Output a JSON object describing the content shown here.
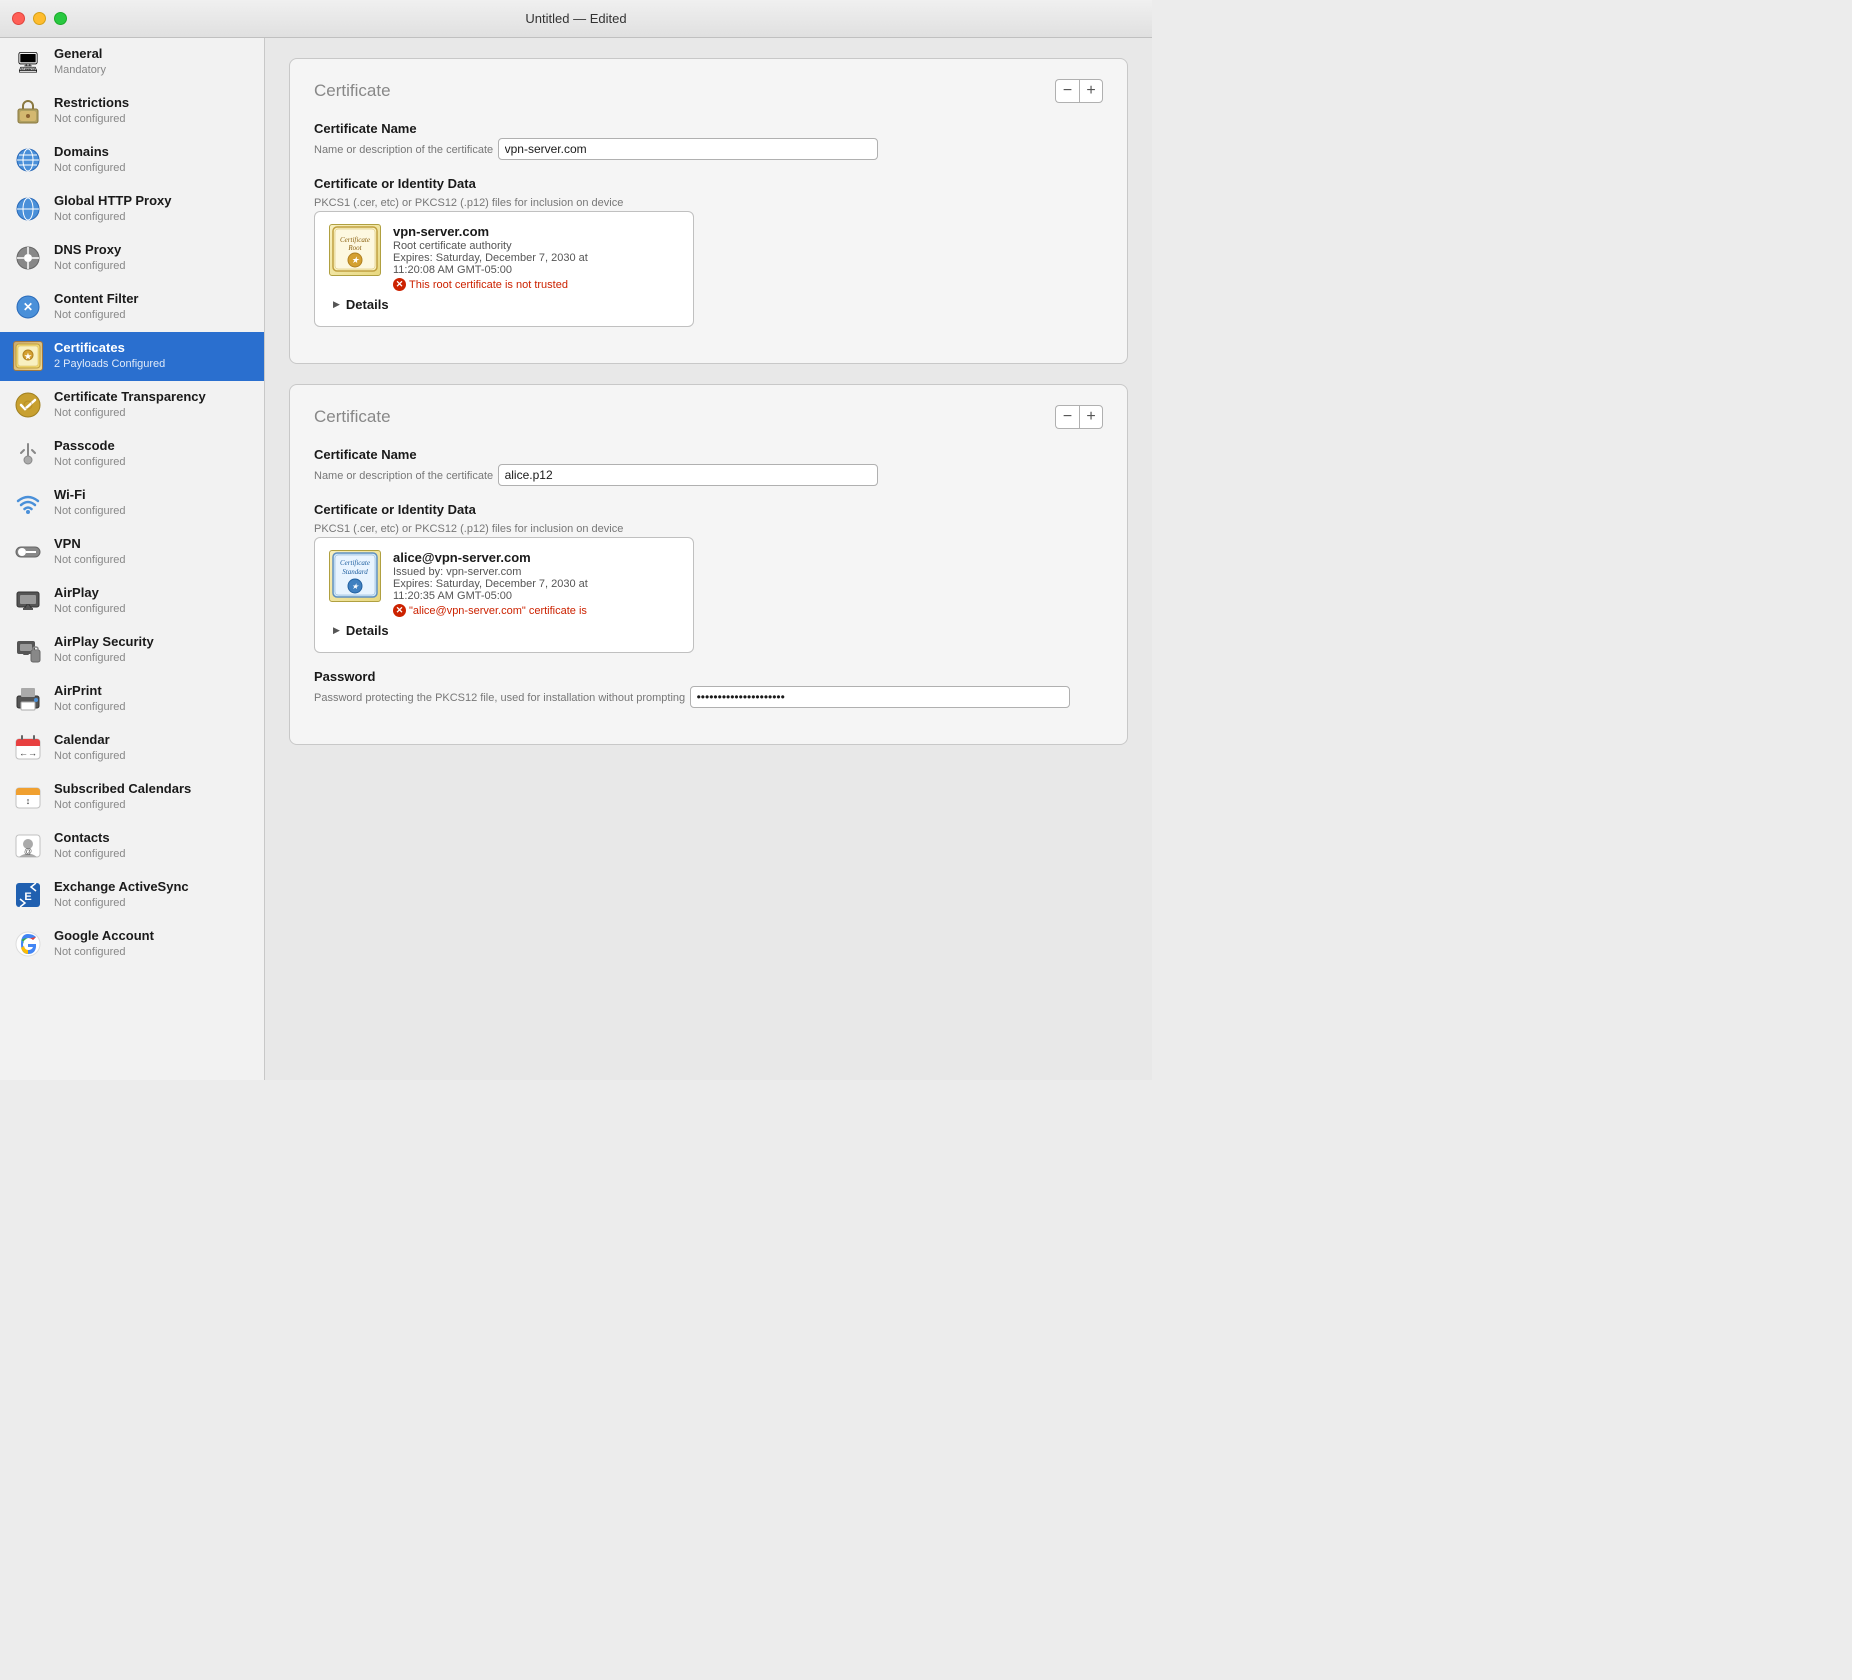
{
  "window": {
    "title": "Untitled — Edited"
  },
  "sidebar": {
    "items": [
      {
        "id": "general",
        "title": "General",
        "subtitle": "Mandatory",
        "icon": "🖥"
      },
      {
        "id": "restrictions",
        "title": "Restrictions",
        "subtitle": "Not configured",
        "icon": "🔒"
      },
      {
        "id": "domains",
        "title": "Domains",
        "subtitle": "Not configured",
        "icon": "🌐"
      },
      {
        "id": "global-http-proxy",
        "title": "Global HTTP Proxy",
        "subtitle": "Not configured",
        "icon": "🌐"
      },
      {
        "id": "dns-proxy",
        "title": "DNS Proxy",
        "subtitle": "Not configured",
        "icon": "🔧"
      },
      {
        "id": "content-filter",
        "title": "Content Filter",
        "subtitle": "Not configured",
        "icon": "🌐"
      },
      {
        "id": "certificates",
        "title": "Certificates",
        "subtitle": "2 Payloads Configured",
        "icon": "cert",
        "active": true
      },
      {
        "id": "cert-transparency",
        "title": "Certificate Transparency",
        "subtitle": "Not configured",
        "icon": "⚙️"
      },
      {
        "id": "passcode",
        "title": "Passcode",
        "subtitle": "Not configured",
        "icon": "🔑"
      },
      {
        "id": "wifi",
        "title": "Wi-Fi",
        "subtitle": "Not configured",
        "icon": "wifi"
      },
      {
        "id": "vpn",
        "title": "VPN",
        "subtitle": "Not configured",
        "icon": "vpn"
      },
      {
        "id": "airplay",
        "title": "AirPlay",
        "subtitle": "Not configured",
        "icon": "airplay"
      },
      {
        "id": "airplay-security",
        "title": "AirPlay Security",
        "subtitle": "Not configured",
        "icon": "airplay-sec"
      },
      {
        "id": "airprint",
        "title": "AirPrint",
        "subtitle": "Not configured",
        "icon": "print"
      },
      {
        "id": "calendar",
        "title": "Calendar",
        "subtitle": "Not configured",
        "icon": "cal"
      },
      {
        "id": "subscribed-calendars",
        "title": "Subscribed Calendars",
        "subtitle": "Not configured",
        "icon": "subcal"
      },
      {
        "id": "contacts",
        "title": "Contacts",
        "subtitle": "Not configured",
        "icon": "contacts"
      },
      {
        "id": "exchange-activesync",
        "title": "Exchange ActiveSync",
        "subtitle": "Not configured",
        "icon": "exchange"
      },
      {
        "id": "google-account",
        "title": "Google Account",
        "subtitle": "Not configured",
        "icon": "google"
      }
    ]
  },
  "main": {
    "cert1": {
      "section_title": "Certificate",
      "cert_name_label": "Certificate Name",
      "cert_name_desc": "Name or description of the certificate",
      "cert_name_value": "vpn-server.com",
      "cert_data_label": "Certificate or Identity Data",
      "cert_data_desc": "PKCS1 (.cer, etc) or PKCS12 (.p12) files for inclusion on device",
      "cert_cn": "vpn-server.com",
      "cert_type": "Root certificate authority",
      "cert_expires": "Expires: Saturday, December 7, 2030 at",
      "cert_expires2": "11:20:08 AM GMT-05:00",
      "cert_error": "This root certificate is not trusted",
      "details_label": "Details",
      "minus_label": "−",
      "plus_label": "+"
    },
    "cert2": {
      "section_title": "Certificate",
      "cert_name_label": "Certificate Name",
      "cert_name_desc": "Name or description of the certificate",
      "cert_name_value": "alice.p12",
      "cert_data_label": "Certificate or Identity Data",
      "cert_data_desc": "PKCS1 (.cer, etc) or PKCS12 (.p12) files for inclusion on device",
      "cert_cn": "alice@vpn-server.com",
      "cert_issuer": "Issued by: vpn-server.com",
      "cert_expires": "Expires: Saturday, December 7, 2030 at",
      "cert_expires2": "11:20:35 AM GMT-05:00",
      "cert_error": "\"alice@vpn-server.com\" certificate is",
      "details_label": "Details",
      "password_label": "Password",
      "password_desc": "Password protecting the PKCS12 file, used for installation without prompting",
      "password_dots": "••••••••••••••••••••••••••••••••",
      "minus_label": "−",
      "plus_label": "+"
    }
  }
}
